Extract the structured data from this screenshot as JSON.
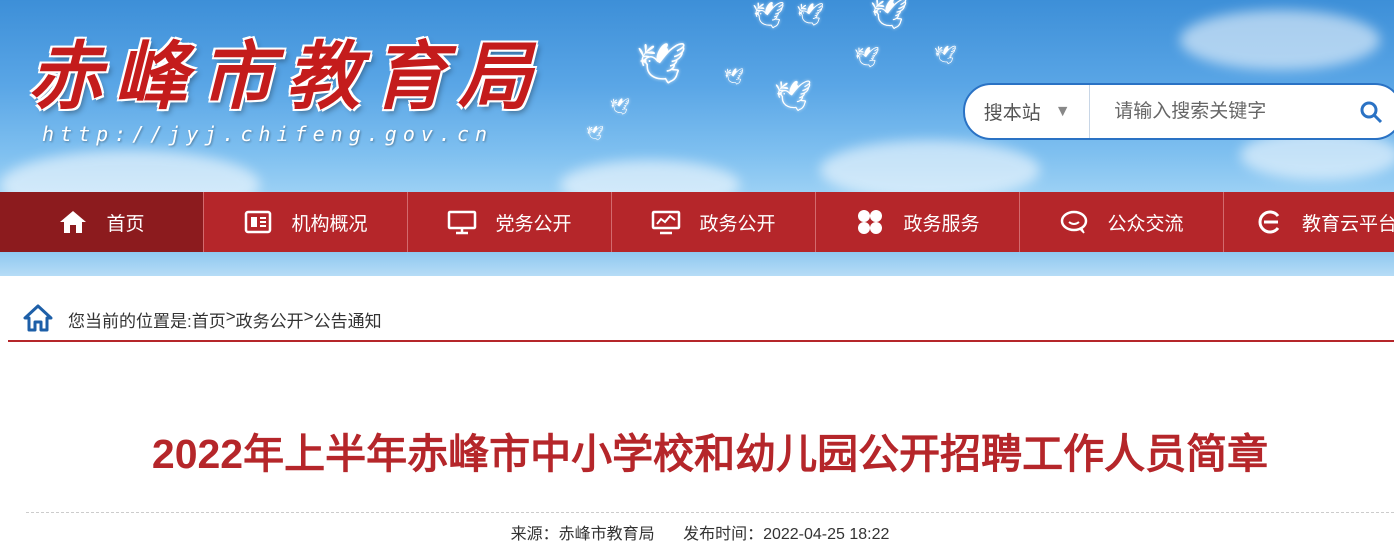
{
  "header": {
    "site_title": "赤峰市教育局",
    "site_url": "http://jyj.chifeng.gov.cn",
    "search": {
      "scope": "搜本站",
      "placeholder": "请输入搜索关键字"
    }
  },
  "nav": {
    "items": [
      {
        "label": "首页",
        "icon": "home-icon"
      },
      {
        "label": "机构概况",
        "icon": "org-icon"
      },
      {
        "label": "党务公开",
        "icon": "monitor-icon"
      },
      {
        "label": "政务公开",
        "icon": "screen-icon"
      },
      {
        "label": "政务服务",
        "icon": "grid-icon"
      },
      {
        "label": "公众交流",
        "icon": "chat-icon"
      },
      {
        "label": "教育云平台",
        "icon": "cloud-e-icon"
      }
    ]
  },
  "breadcrumb": {
    "prefix": "您当前的位置是:",
    "items": [
      "首页",
      "政务公开",
      "公告通知"
    ],
    "separator": ">"
  },
  "article": {
    "title": "2022年上半年赤峰市中小学校和幼儿园公开招聘工作人员简章",
    "source": "来源：赤峰市教育局",
    "publish_time": "发布时间：2022-04-25 18:22"
  },
  "colors": {
    "brand_red": "#b5262a",
    "nav_active": "#8c1b1e",
    "sky_blue": "#5aa6e6",
    "search_border": "#2a72c4"
  }
}
